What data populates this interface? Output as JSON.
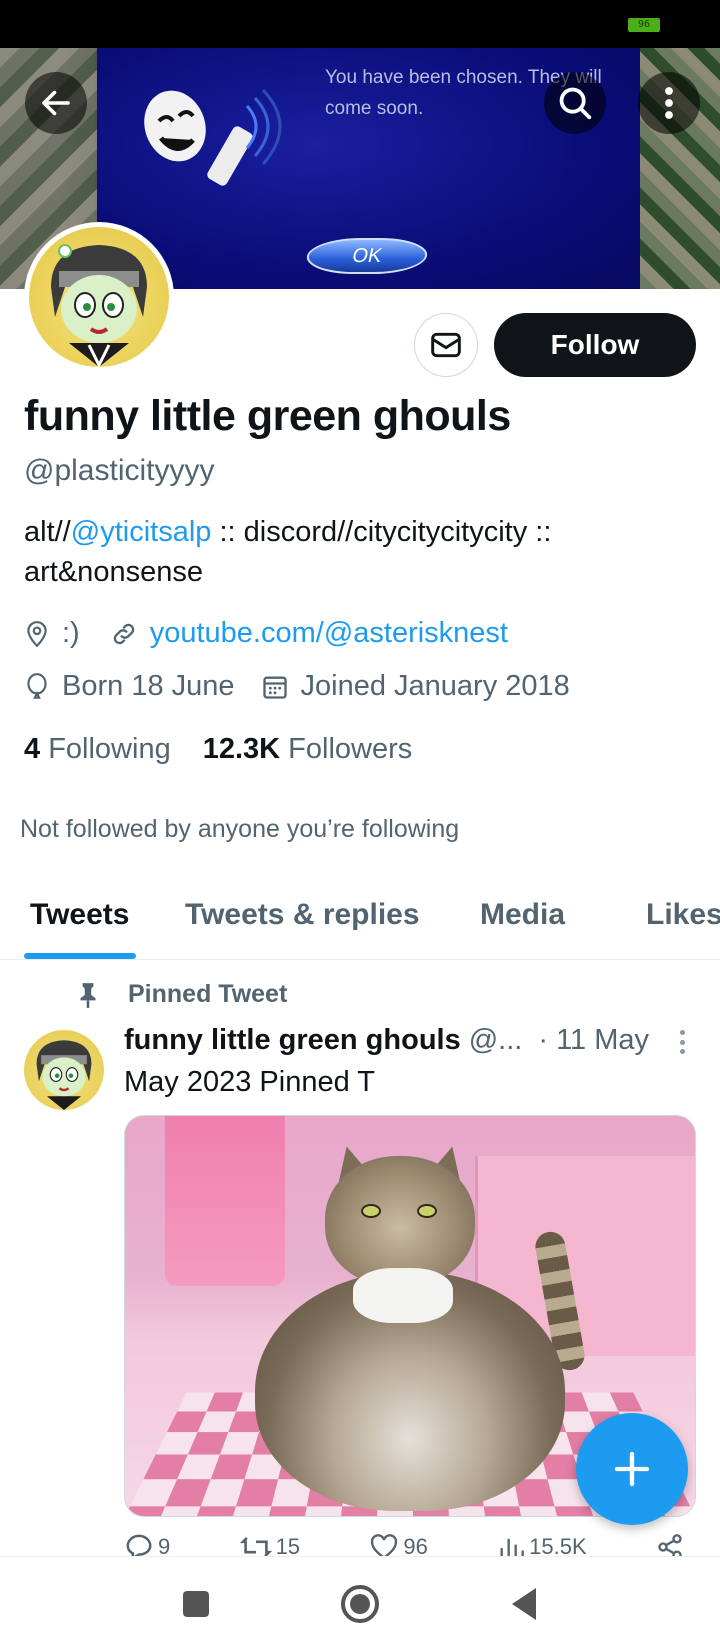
{
  "status_bar": {
    "battery": "96"
  },
  "banner": {
    "dialog_text": "You have been chosen. They will come soon.",
    "ok_label": "OK"
  },
  "toolbar": {
    "back": "back-arrow-icon",
    "search": "search-icon",
    "more": "more-vertical-icon"
  },
  "profile": {
    "display_name": "funny little green ghouls",
    "handle": "@plasticityyyy",
    "bio_prefix": "alt//",
    "bio_mention": "@yticitsalp",
    "bio_rest": " :: discord//citycitycitycity :: art&nonsense",
    "location": ":)",
    "website": "youtube.com/@asterisknest",
    "birthday": "Born 18 June",
    "joined": "Joined January 2018",
    "following_count": "4",
    "following_label": "Following",
    "followers_count": "12.3K",
    "followers_label": "Followers",
    "not_followed": "Not followed by anyone you’re following",
    "follow_label": "Follow"
  },
  "tabs": [
    "Tweets",
    "Tweets & replies",
    "Media",
    "Likes"
  ],
  "pinned_tweet": {
    "pinned_label": "Pinned Tweet",
    "author": "funny little green ghouls",
    "handle": "@...",
    "date": "· 11 May",
    "text": "May 2023 Pinned T",
    "replies": "9",
    "retweets": "15",
    "likes": "96",
    "views": "15.5K"
  },
  "colors": {
    "accent": "#1d9bf0",
    "text": "#0f1419",
    "muted": "#536471",
    "follow_bg": "#0f1419"
  }
}
